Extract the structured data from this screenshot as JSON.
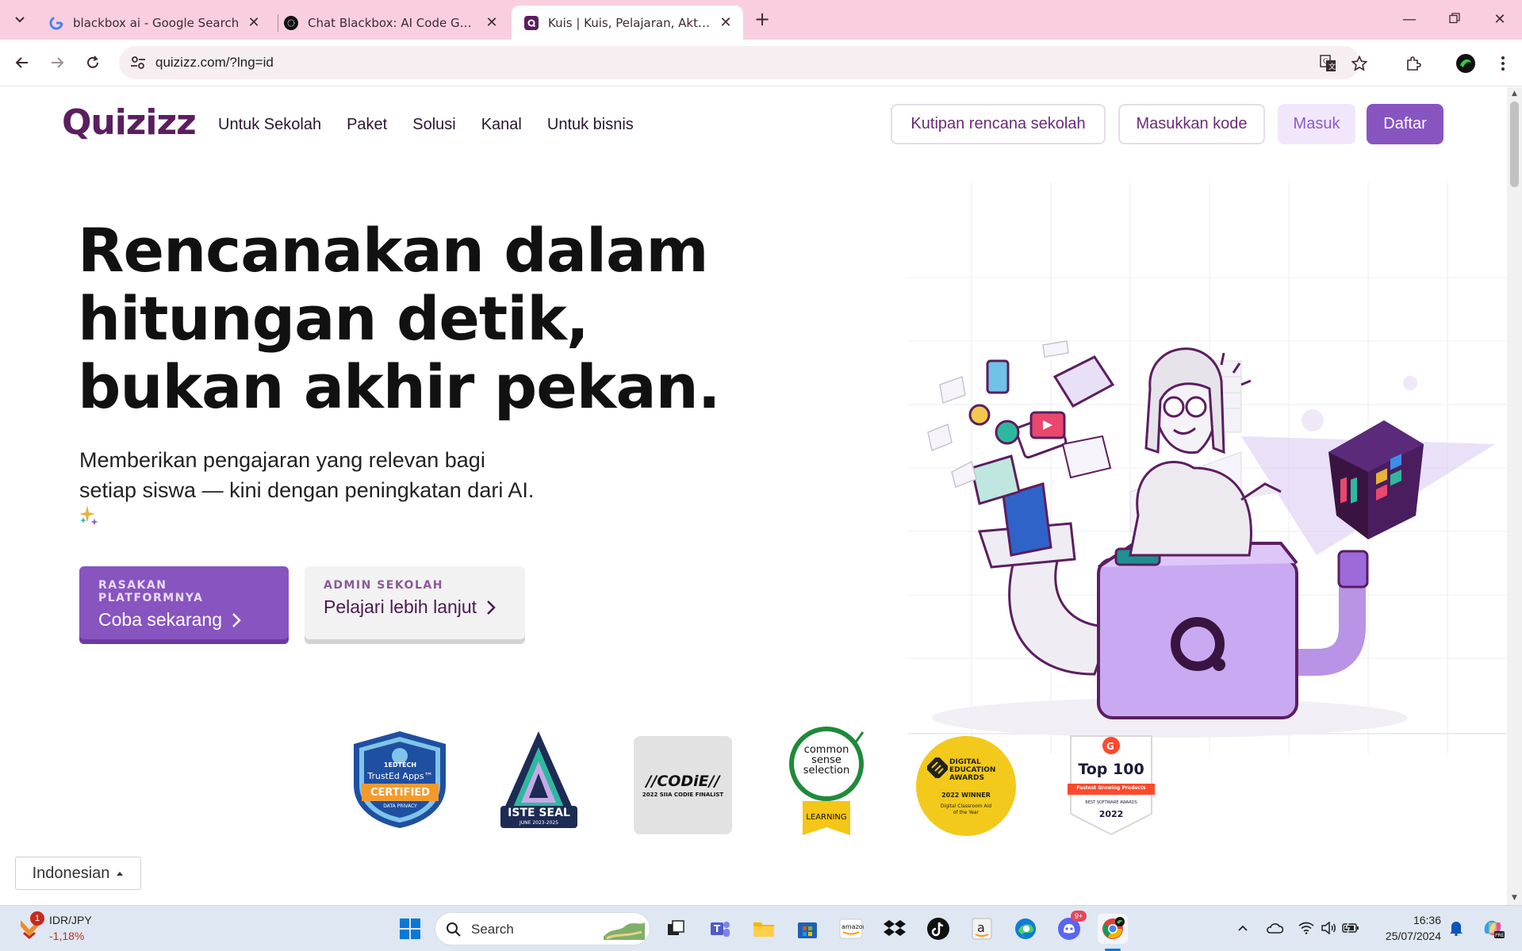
{
  "browser": {
    "tabs": [
      {
        "title": "blackbox ai - Google Search",
        "favicon": "google-icon",
        "active": false
      },
      {
        "title": "Chat Blackbox: AI Code Generat",
        "favicon": "blackbox-icon",
        "active": false
      },
      {
        "title": "Kuis | Kuis, Pelajaran, Aktivitas, d",
        "favicon": "quizizz-icon",
        "active": true
      }
    ],
    "url": "quizizz.com/?lng=id"
  },
  "header": {
    "logo_text": "Quizizz",
    "nav": [
      "Untuk Sekolah",
      "Paket",
      "Solusi",
      "Kanal",
      "Untuk bisnis"
    ],
    "buttons": {
      "quote": "Kutipan rencana sekolah",
      "code": "Masukkan kode",
      "login": "Masuk",
      "signup": "Daftar"
    }
  },
  "hero": {
    "title_lines": [
      "Rencanakan dalam",
      "hitungan detik,",
      "bukan akhir pekan."
    ],
    "subtitle_lines": [
      "Memberikan pengajaran yang relevan bagi",
      "setiap siswa — kini dengan peningkatan dari AI."
    ],
    "cta_primary": {
      "small": "RASAKAN PLATFORMNYA",
      "big": "Coba sekarang"
    },
    "cta_secondary": {
      "small": "ADMIN SEKOLAH",
      "big": "Pelajari lebih lanjut"
    }
  },
  "badges": {
    "trusted": {
      "top": "1EDTECH",
      "brand": "TrustEd Apps™",
      "main": "CERTIFIED",
      "sub": "DATA PRIVACY"
    },
    "iste": {
      "main": "ISTE SEAL",
      "sub": "JUNE 2023-2025"
    },
    "codie": {
      "main": "//CODiE//",
      "sub": "2022 SIIA CODIE FINALIST"
    },
    "common_sense": {
      "lines": [
        "common",
        "sense",
        "selection"
      ],
      "ribbon": "LEARNING"
    },
    "digital_edu": {
      "lines": [
        "DIGITAL",
        "EDUCATION",
        "AWARDS"
      ],
      "winner": "2022 WINNER",
      "sub1": "Digital Classroom Aid",
      "sub2": "of the Year"
    },
    "g2": {
      "main": "Top 100",
      "ribbon": "Fastest Growing Products",
      "sub": "BEST SOFTWARE AWARDS",
      "year": "2022"
    }
  },
  "language_button": "Indonesian",
  "taskbar": {
    "stock_name": "IDR/JPY",
    "stock_change": "-1,18%",
    "notification_count": "1",
    "search_label": "Search",
    "discord_badge": "9+",
    "time": "16:36",
    "date": "25/07/2024"
  },
  "colors": {
    "brand_purple": "#8854c0",
    "logo_purple": "#5b1e5f",
    "tabbar_pink": "#f9cfe0"
  }
}
